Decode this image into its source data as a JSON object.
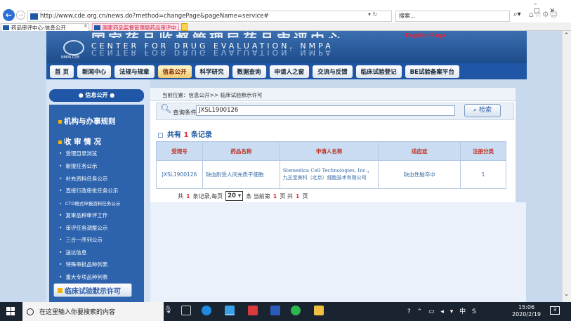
{
  "browser": {
    "url": "http://www.cde.org.cn/news.do?method=changePage&pageName=service#",
    "search_placeholder": "搜索...",
    "tabs": [
      {
        "label": "药品审评中心-信息公开"
      },
      {
        "label": "国家药品监督管理局药品审评中..."
      }
    ]
  },
  "banner": {
    "title_cn": "国家药品监督管理局药品审评中心",
    "title_en": "CENTER FOR DRUG EVALUATION, NMPA",
    "abbr": "NMPA CDE",
    "english_link": "English Page"
  },
  "nav": {
    "items": [
      {
        "label": "首 页"
      },
      {
        "label": "新闻中心"
      },
      {
        "label": "法规与规章"
      },
      {
        "label": "信息公开",
        "active": true
      },
      {
        "label": "科学研究"
      },
      {
        "label": "数据查询"
      },
      {
        "label": "申请人之窗"
      },
      {
        "label": "交流与反馈"
      },
      {
        "label": "临床试验登记"
      },
      {
        "label": "BE试验备案平台"
      }
    ]
  },
  "sidebar": {
    "head": "信息公开",
    "section1": "机构与办事规则",
    "section2": "收 审 情 况",
    "items": [
      "受理目录浏览",
      "新报任务公示",
      "补充资料任务公示",
      "直接行政审批任务公示",
      "CTD格式申报资料任务公示",
      "复审品种审评工作",
      "审评任务调整公示",
      "三合一序列公示",
      "送达信息",
      "特殊审批品种列表",
      "重大专项品种列表"
    ],
    "button": "临床试验默示许可"
  },
  "main": {
    "breadcrumb": "当前位置：信息公开>> 临床试验默示许可",
    "query_label": "查询条件：",
    "query_value": "JXSL1900126",
    "search_button": "检索",
    "total_prefix": "共有",
    "total_count": "1",
    "total_suffix": "条记录",
    "table": {
      "headers": [
        "受理号",
        "药品名称",
        "申请人名称",
        "适应症",
        "注册分类"
      ],
      "rows": [
        [
          "JXSL1900126",
          "缺血耐受人间充质干细胞",
          "Stemedica Cell Technologies, Inc.，九芝堂美科（北京）细胞技术有限公司",
          "缺血性脑卒中",
          "1"
        ]
      ]
    },
    "pager": {
      "p1": "共",
      "records": "1",
      "p2": "条记录,每页",
      "per_page": "20",
      "p3": "条 当前第",
      "current": "1",
      "p4": "页 共",
      "pages": "1",
      "p5": "页"
    }
  },
  "taskbar": {
    "search_placeholder": "在这里输入你要搜索的内容",
    "time": "15:06",
    "date": "2020/2/19",
    "ime": "中",
    "notif_count": "3"
  }
}
